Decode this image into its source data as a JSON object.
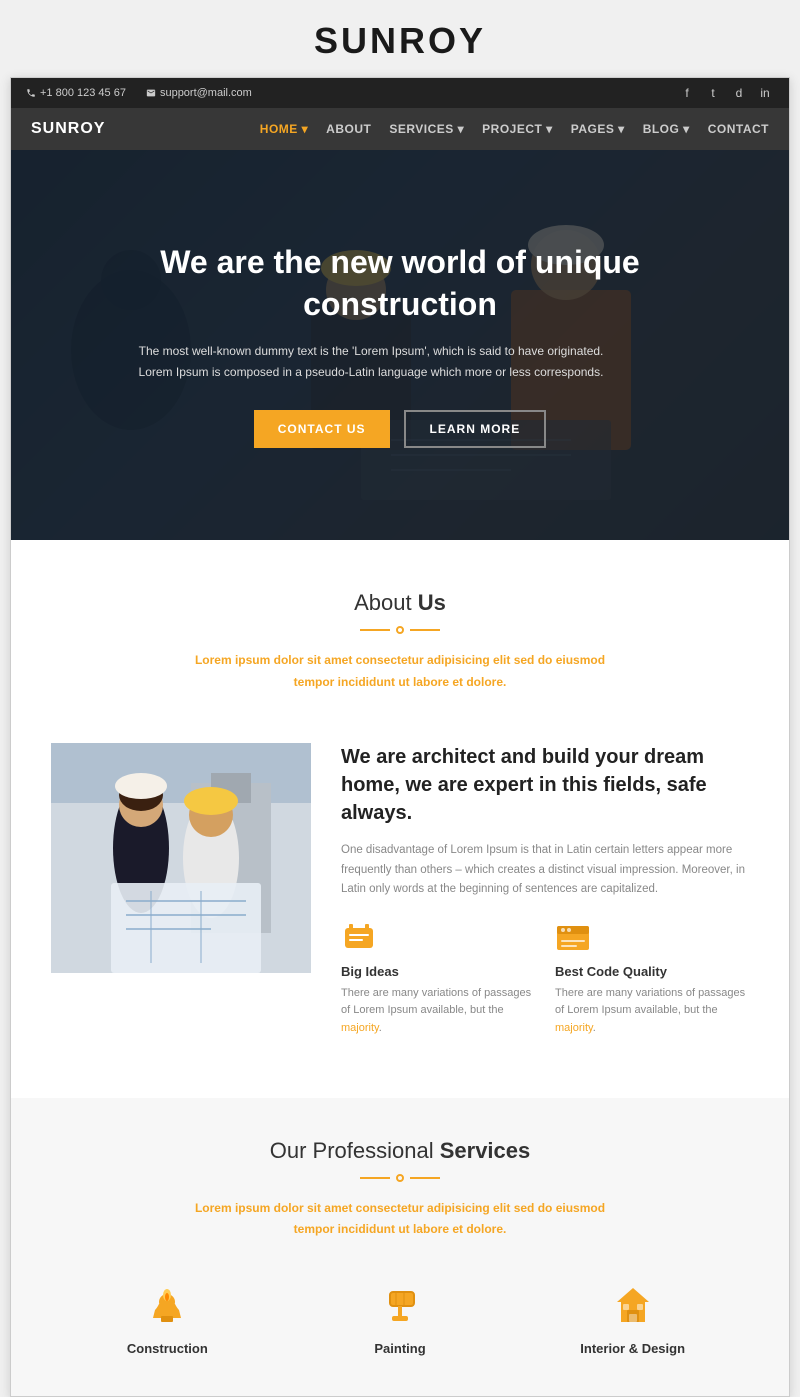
{
  "page": {
    "site_title": "SUNROY"
  },
  "topbar": {
    "phone": "+1 800 123 45 67",
    "email": "support@mail.com",
    "social": [
      "f",
      "t",
      "d",
      "in"
    ]
  },
  "navbar": {
    "brand": "SUNROY",
    "items": [
      {
        "label": "HOME",
        "active": true
      },
      {
        "label": "ABOUT",
        "active": false
      },
      {
        "label": "SERVICES",
        "active": false
      },
      {
        "label": "PROJECT",
        "active": false
      },
      {
        "label": "PAGES",
        "active": false
      },
      {
        "label": "BLOG",
        "active": false
      },
      {
        "label": "CONTACT",
        "active": false
      }
    ]
  },
  "hero": {
    "heading": "We are the new world of unique construction",
    "description": "The most well-known dummy text is the 'Lorem Ipsum', which is said to have originated. Lorem Ipsum is composed in a pseudo-Latin language which more or less corresponds.",
    "btn_primary": "CONTACT US",
    "btn_secondary": "LEARN MORE"
  },
  "about": {
    "section_title_normal": "About",
    "section_title_bold": "Us",
    "subtitle_line1": "Lorem ipsum dolor sit amet consectetur",
    "subtitle_link": "adipisicing elit sed do eiusmod",
    "subtitle_line2": "tempor incididunt ut labore et dolore.",
    "heading": "We are architect and build your dream home, we are expert in this fields, safe always.",
    "description": "One disadvantage of Lorem Ipsum is that in Latin certain letters appear more frequently than others – which creates a distinct visual impression. Moreover, in Latin only words at the beginning of sentences are capitalized.",
    "features": [
      {
        "title": "Big Ideas",
        "description": "There are many variations of passages of Lorem Ipsum available, but the majority.",
        "icon": "💡"
      },
      {
        "title": "Best Code Quality",
        "description": "There are many variations of passages of Lorem Ipsum available, but the majority.",
        "icon": "📁"
      }
    ]
  },
  "services": {
    "section_title_normal": "Our Professional",
    "section_title_bold": "Services",
    "subtitle_line1": "Lorem ipsum dolor sit amet consectetur",
    "subtitle_link": "adipisicing elit sed do eiusmod",
    "subtitle_line2": "tempor incididunt ut labore et dolore.",
    "items": [
      {
        "title": "Construction",
        "icon": "🔥"
      },
      {
        "title": "Painting",
        "icon": "🖌"
      },
      {
        "title": "Interior & Design",
        "icon": "🏠"
      }
    ]
  }
}
